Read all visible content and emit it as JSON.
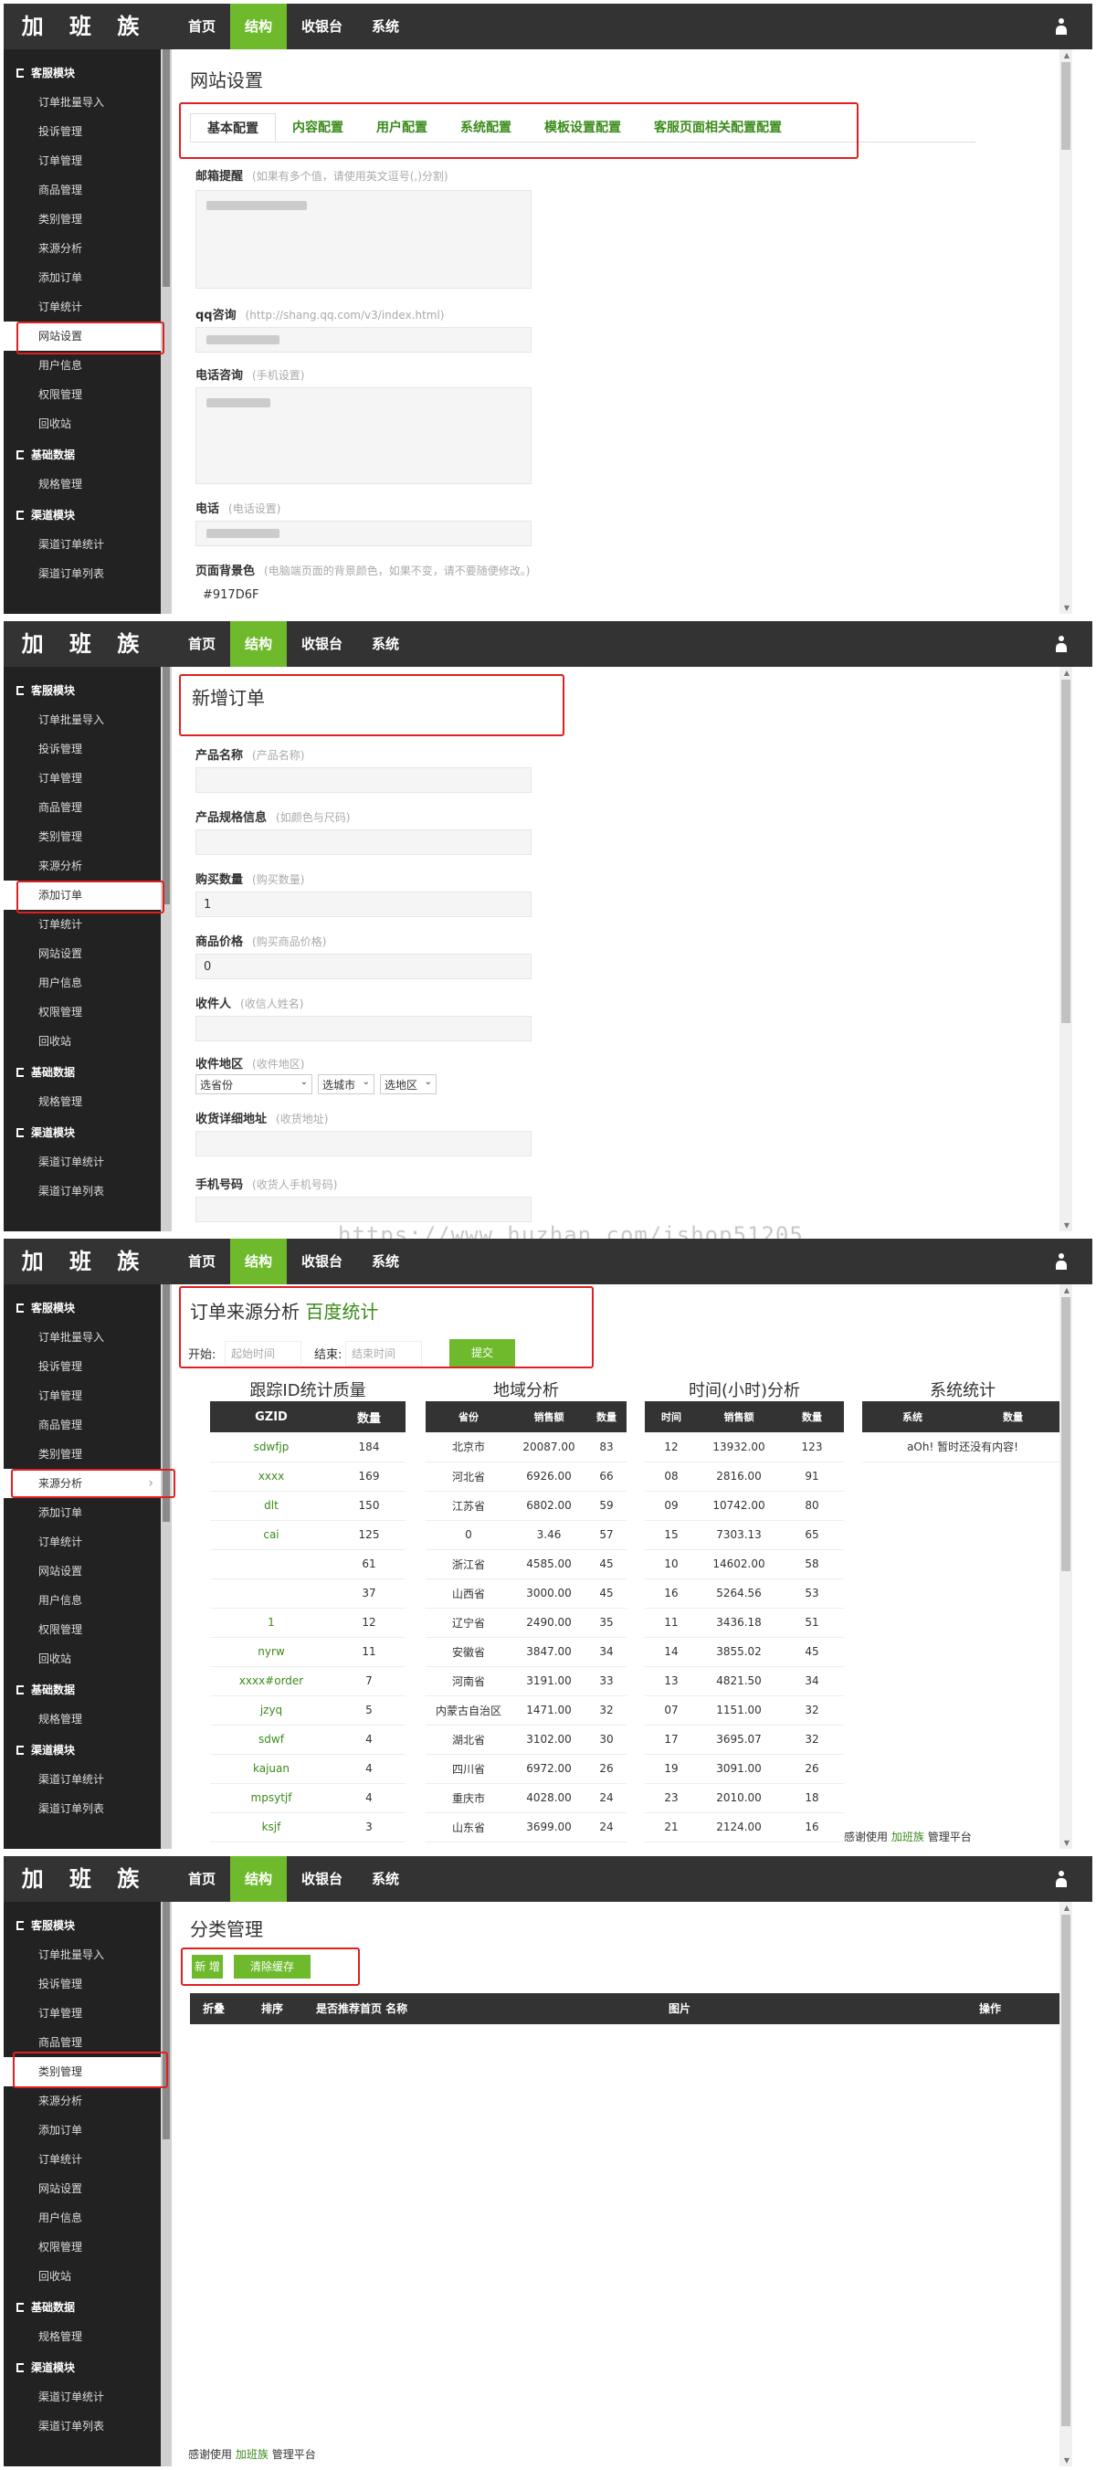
{
  "brand": "加 班 族",
  "nav": [
    "首页",
    "结构",
    "收银台",
    "系统"
  ],
  "nav_active_index": 1,
  "sidebar": {
    "group_customer": "客服模块",
    "items": [
      "订单批量导入",
      "投诉管理",
      "订单管理",
      "商品管理",
      "类别管理",
      "来源分析",
      "添加订单",
      "订单统计",
      "网站设置",
      "用户信息",
      "权限管理",
      "回收站"
    ],
    "group_basic": "基础数据",
    "basic_items": [
      "规格管理"
    ],
    "group_channel": "渠道模块",
    "channel_items": [
      "渠道订单统计",
      "渠道订单列表"
    ]
  },
  "panel1": {
    "title": "网站设置",
    "tabs": [
      "基本配置",
      "内容配置",
      "用户配置",
      "系统配置",
      "模板设置配置",
      "客服页面相关配置配置"
    ],
    "fields": [
      {
        "label": "邮箱提醒",
        "hint": "(如果有多个值，请使用英文逗号(,)分割)"
      },
      {
        "label": "qq咨询",
        "hint": "(http://shang.qq.com/v3/index.html)"
      },
      {
        "label": "电话咨询",
        "hint": "(手机设置)"
      },
      {
        "label": "电话",
        "hint": "(电话设置)"
      },
      {
        "label": "页面背景色",
        "hint": "(电脑端页面的背景颜色，如果不变，请不要随便修改。)"
      }
    ],
    "bg_color_value": "#917D6F"
  },
  "panel2": {
    "title": "新增订单",
    "fields": [
      {
        "label": "产品名称",
        "hint": "(产品名称)",
        "value": ""
      },
      {
        "label": "产品规格信息",
        "hint": "(如颜色与尺码)",
        "value": ""
      },
      {
        "label": "购买数量",
        "hint": "(购买数量)",
        "value": "1"
      },
      {
        "label": "商品价格",
        "hint": "(购买商品价格)",
        "value": "0"
      },
      {
        "label": "收件人",
        "hint": "(收信人姓名)",
        "value": ""
      },
      {
        "label": "收件地区",
        "hint": "(收件地区)",
        "value": ""
      },
      {
        "label": "收货详细地址",
        "hint": "(收货地址)",
        "value": ""
      },
      {
        "label": "手机号码",
        "hint": "(收货人手机号码)",
        "value": ""
      }
    ],
    "region_selects": [
      "选省份",
      "选城市",
      "选地区"
    ]
  },
  "watermark": "https://www.huzhan.com/ishop51205",
  "panel3": {
    "title": "订单来源分析",
    "title_link": "百度统计",
    "start_label": "开始:",
    "start_placeholder": "起始时间",
    "end_label": "结束:",
    "end_placeholder": "结束时间",
    "submit": "提交",
    "gzid": {
      "title": "跟踪ID统计质量",
      "headers": [
        "GZID",
        "数量"
      ],
      "rows": [
        [
          "sdwfjp",
          "184"
        ],
        [
          "xxxx",
          "169"
        ],
        [
          "dlt",
          "150"
        ],
        [
          "cai",
          "125"
        ],
        [
          "",
          "61"
        ],
        [
          "",
          "37"
        ],
        [
          "1",
          "12"
        ],
        [
          "nyrw",
          "11"
        ],
        [
          "xxxx#order",
          "7"
        ],
        [
          "jzyq",
          "5"
        ],
        [
          "sdwf",
          "4"
        ],
        [
          "kajuan",
          "4"
        ],
        [
          "mpsytjf",
          "4"
        ],
        [
          "ksjf",
          "3"
        ]
      ]
    },
    "region": {
      "title": "地域分析",
      "headers": [
        "省份",
        "销售额",
        "数量"
      ],
      "rows": [
        [
          "北京市",
          "20087.00",
          "83"
        ],
        [
          "河北省",
          "6926.00",
          "66"
        ],
        [
          "江苏省",
          "6802.00",
          "59"
        ],
        [
          "0",
          "3.46",
          "57"
        ],
        [
          "浙江省",
          "4585.00",
          "45"
        ],
        [
          "山西省",
          "3000.00",
          "45"
        ],
        [
          "辽宁省",
          "2490.00",
          "35"
        ],
        [
          "安徽省",
          "3847.00",
          "34"
        ],
        [
          "河南省",
          "3191.00",
          "33"
        ],
        [
          "内蒙古自治区",
          "1471.00",
          "32"
        ],
        [
          "湖北省",
          "3102.00",
          "30"
        ],
        [
          "四川省",
          "6972.00",
          "26"
        ],
        [
          "重庆市",
          "4028.00",
          "24"
        ],
        [
          "山东省",
          "3699.00",
          "24"
        ]
      ]
    },
    "time": {
      "title": "时间(小时)分析",
      "headers": [
        "时间",
        "销售额",
        "数量"
      ],
      "rows": [
        [
          "12",
          "13932.00",
          "123"
        ],
        [
          "08",
          "2816.00",
          "91"
        ],
        [
          "09",
          "10742.00",
          "80"
        ],
        [
          "15",
          "7303.13",
          "65"
        ],
        [
          "10",
          "14602.00",
          "58"
        ],
        [
          "16",
          "5264.56",
          "53"
        ],
        [
          "11",
          "3436.18",
          "51"
        ],
        [
          "14",
          "3855.02",
          "45"
        ],
        [
          "13",
          "4821.50",
          "34"
        ],
        [
          "07",
          "1151.00",
          "32"
        ],
        [
          "17",
          "3695.07",
          "32"
        ],
        [
          "19",
          "3091.00",
          "26"
        ],
        [
          "23",
          "2010.00",
          "18"
        ],
        [
          "21",
          "2124.00",
          "16"
        ]
      ]
    },
    "system": {
      "title": "系统统计",
      "headers": [
        "系统",
        "数量"
      ],
      "empty": "aOh! 暂时还没有内容!"
    },
    "footer_prefix": "感谢使用",
    "footer_link": "加班族",
    "footer_suffix": "管理平台"
  },
  "panel4": {
    "title": "分类管理",
    "btn_new": "新 增",
    "btn_clear": "清除缓存",
    "headers": [
      "折叠",
      "排序",
      "是否推荐首页 名称",
      "图片",
      "操作"
    ],
    "footer_prefix": "感谢使用",
    "footer_link": "加班族",
    "footer_suffix": "管理平台"
  }
}
